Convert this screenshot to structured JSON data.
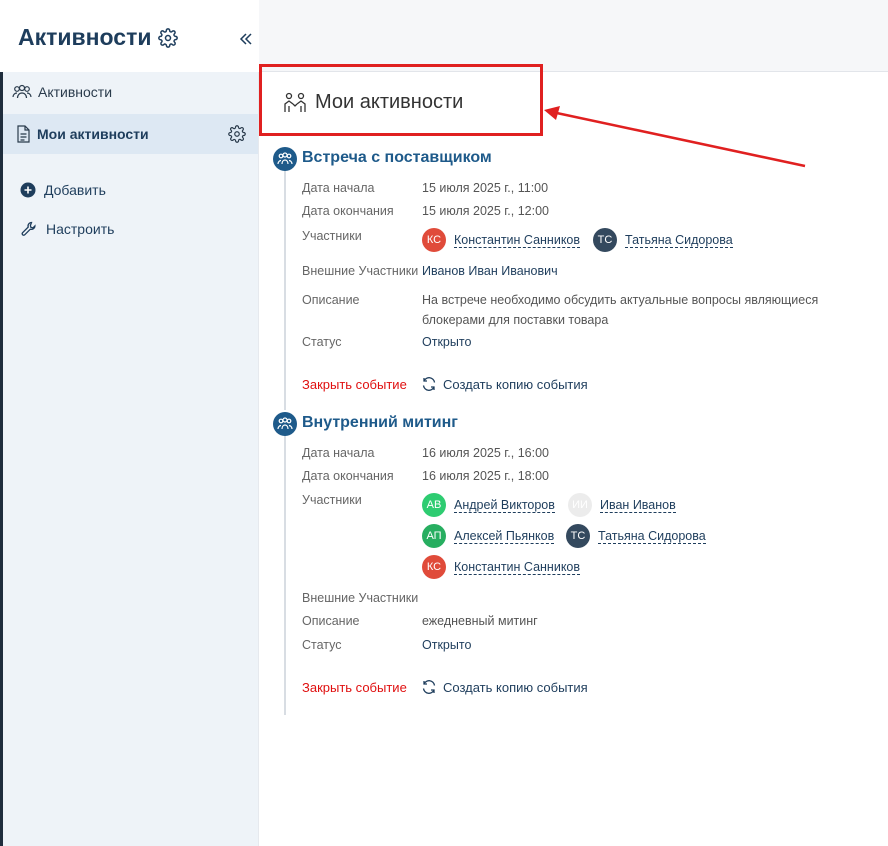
{
  "sidebar": {
    "title": "Активности",
    "nav": [
      {
        "label": "Активности",
        "icon": "people-group-icon"
      },
      {
        "label": "Мои активности",
        "icon": "document-icon"
      }
    ],
    "actions": [
      {
        "label": "Добавить",
        "icon": "plus-circle-icon"
      },
      {
        "label": "Настроить",
        "icon": "wrench-icon"
      }
    ]
  },
  "main": {
    "title": "Мои активности",
    "events": [
      {
        "title": "Встреча с поставщиком",
        "labels": {
          "start": "Дата начала",
          "end": "Дата окончания",
          "participants": "Участники",
          "external": "Внешние Участники",
          "description": "Описание",
          "status": "Статус"
        },
        "start": "15 июля 2025 г., 11:00",
        "end": "15 июля 2025 г., 12:00",
        "participants": [
          {
            "initials": "КС",
            "name": "Константин Санников",
            "color": "#e04b3a"
          },
          {
            "initials": "ТС",
            "name": "Татьяна Сидорова",
            "color": "#34495e"
          }
        ],
        "external": "Иванов Иван Иванович",
        "description": "На встрече необходимо обсудить актуальные вопросы являющиеся блокерами для поставки товара",
        "status": "Открыто",
        "close_label": "Закрыть событие",
        "copy_label": "Создать копию события"
      },
      {
        "title": "Внутренний митинг",
        "labels": {
          "start": "Дата начала",
          "end": "Дата окончания",
          "participants": "Участники",
          "external": "Внешние Участники",
          "description": "Описание",
          "status": "Статус"
        },
        "start": "16 июля 2025 г., 16:00",
        "end": "16 июля 2025 г., 18:00",
        "participants": [
          {
            "initials": "АВ",
            "name": "Андрей Викторов",
            "color": "#2ecc71"
          },
          {
            "initials": "ИИ",
            "name": "Иван Иванов",
            "color": "#ececec"
          },
          {
            "initials": "АП",
            "name": "Алексей Пьянков",
            "color": "#27ae60"
          },
          {
            "initials": "ТС",
            "name": "Татьяна Сидорова",
            "color": "#34495e"
          },
          {
            "initials": "КС",
            "name": "Константин Санников",
            "color": "#e04b3a"
          }
        ],
        "external": "",
        "description": "ежедневный митинг",
        "status": "Открыто",
        "close_label": "Закрыть событие",
        "copy_label": "Создать копию события"
      }
    ]
  },
  "colors": {
    "accent": "#1e5a8a",
    "danger": "#e01010",
    "annotation": "#e02020"
  }
}
